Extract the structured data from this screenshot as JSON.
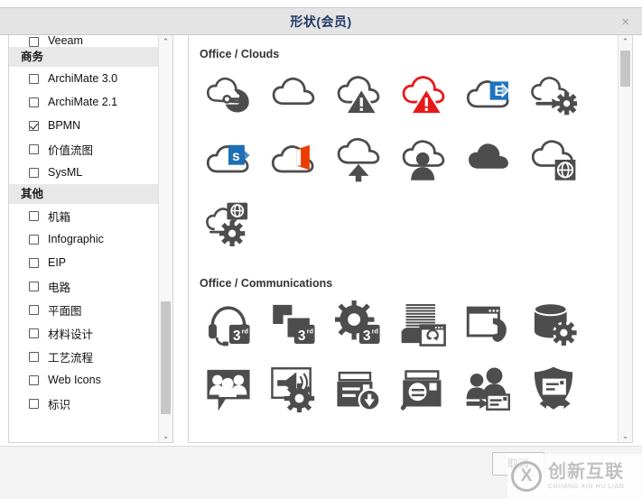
{
  "dialog": {
    "title": "形状(会员)",
    "close_label": "×"
  },
  "sidebar": {
    "cut_item": {
      "label": "Veeam",
      "checked": false
    },
    "groups": [
      {
        "header": "商务",
        "items": [
          {
            "label": "ArchiMate 3.0",
            "checked": false
          },
          {
            "label": "ArchiMate 2.1",
            "checked": false
          },
          {
            "label": "BPMN",
            "checked": true
          },
          {
            "label": "价值流图",
            "checked": false
          },
          {
            "label": "SysML",
            "checked": false
          }
        ]
      },
      {
        "header": "其他",
        "items": [
          {
            "label": "机箱",
            "checked": false
          },
          {
            "label": "Infographic",
            "checked": false
          },
          {
            "label": "EIP",
            "checked": false
          },
          {
            "label": "电路",
            "checked": false
          },
          {
            "label": "平面图",
            "checked": false
          },
          {
            "label": "材料设计",
            "checked": false
          },
          {
            "label": "工艺流程",
            "checked": false
          },
          {
            "label": "Web Icons",
            "checked": false
          },
          {
            "label": "标识",
            "checked": false
          }
        ]
      }
    ],
    "scroll": {
      "up_arrow": "⌃",
      "down_arrow": "⌄"
    }
  },
  "content": {
    "sections": [
      {
        "title": "Office / Clouds",
        "icons": [
          {
            "name": "cloud-connect-icon"
          },
          {
            "name": "cloud-outline-icon"
          },
          {
            "name": "cloud-warning-icon"
          },
          {
            "name": "cloud-alert-red-icon",
            "color": "#e8191b"
          },
          {
            "name": "cloud-exchange-icon",
            "color": "#1e73be"
          },
          {
            "name": "cloud-arrow-gear-icon"
          },
          {
            "name": "cloud-sharepoint-icon",
            "color": "#1e6eb5"
          },
          {
            "name": "cloud-office-icon",
            "color": "#eb3c00"
          },
          {
            "name": "cloud-upload-icon"
          },
          {
            "name": "cloud-user-icon"
          },
          {
            "name": "cloud-solid-icon"
          },
          {
            "name": "cloud-globe-icon"
          },
          {
            "name": "cloud-globe-gear-icon"
          }
        ]
      },
      {
        "title": "Office / Communications",
        "icons": [
          {
            "name": "headset-3rd-party-icon",
            "badge": "3rd"
          },
          {
            "name": "blocks-3rd-party-icon",
            "badge": "3rd"
          },
          {
            "name": "gear-3rd-party-icon",
            "badge": "3rd"
          },
          {
            "name": "documents-sync-window-icon"
          },
          {
            "name": "window-phone-icon"
          },
          {
            "name": "database-gear-icon"
          },
          {
            "name": "group-chat-icon"
          },
          {
            "name": "announcement-settings-icon"
          },
          {
            "name": "mail-download-icon"
          },
          {
            "name": "mail-search-icon"
          },
          {
            "name": "user-mail-transfer-icon"
          },
          {
            "name": "shield-mail-exchange-icon"
          }
        ]
      }
    ],
    "scroll": {
      "up_arrow": "⌃",
      "down_arrow": "⌄"
    }
  },
  "footer": {
    "button_label": "取消"
  },
  "watermark": {
    "cn": "创新互联",
    "en": "CHUANG XIN HU LIAN",
    "mark": "X"
  },
  "colors": {
    "title": "#1f3864",
    "icon_dark": "#4d4d4d",
    "red": "#e8191b",
    "blue": "#1e73be",
    "orange": "#eb3c00",
    "titlebar_bg": "#e4e4e4",
    "group_header_bg": "#e8e8e8"
  }
}
